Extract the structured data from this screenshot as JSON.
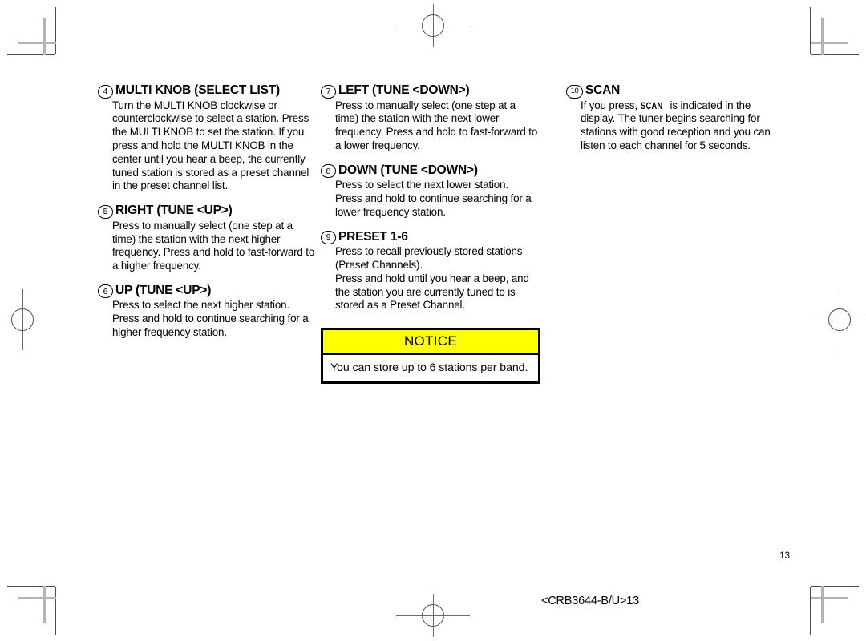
{
  "document": {
    "page_number": "13",
    "footer_code": "<CRB3644-B/U>13"
  },
  "columns": [
    {
      "id": "column-1",
      "entries": [
        {
          "number": "4",
          "title": "MULTI KNOB (SELECT LIST)",
          "paragraphs": [
            "Turn the MULTI KNOB clockwise or counterclockwise to select a station. Press the MULTI KNOB to set the station. If you press and hold the MULTI KNOB in the center until you hear a beep, the currently tuned station is stored as a preset channel in the preset channel list."
          ]
        },
        {
          "number": "5",
          "title": "RIGHT (TUNE <UP>)",
          "paragraphs": [
            "Press to manually select (one step at a time) the station with the next higher frequency. Press and hold to fast-forward to a higher frequency."
          ]
        },
        {
          "number": "6",
          "title": "UP (TUNE <UP>)",
          "paragraphs": [
            "Press to select the next higher station.",
            "Press and hold to continue searching for a higher frequency station."
          ]
        }
      ]
    },
    {
      "id": "column-2",
      "entries": [
        {
          "number": "7",
          "title": "LEFT (TUNE <DOWN>)",
          "paragraphs": [
            "Press to manually select (one step at a time) the station with the next lower frequency. Press and hold to fast-forward to a lower frequency."
          ]
        },
        {
          "number": "8",
          "title": "DOWN (TUNE <DOWN>)",
          "paragraphs": [
            "Press to select the next lower station.",
            "Press and hold to continue searching for a lower frequency station."
          ]
        },
        {
          "number": "9",
          "title": "PRESET 1-6",
          "paragraphs": [
            "Press to recall previously stored stations (Preset Channels).",
            "Press and hold until you hear a beep, and the station you are currently tuned to is stored as a Preset Channel."
          ]
        }
      ]
    },
    {
      "id": "column-3",
      "entries": [
        {
          "number": "10",
          "title": "SCAN",
          "body_before_token": "If you press, ",
          "body_token": "SCAN",
          "body_after_token": " is indicated in the display. The tuner begins searching for stations with good reception and you can listen to each channel for 5 seconds."
        }
      ]
    }
  ],
  "notice": {
    "header": "NOTICE",
    "body": "You can store up to 6 stations per band."
  },
  "colors": {
    "notice_header_background": "#FFFF00",
    "notice_border": "#000000",
    "text": "#000000",
    "crop_mark_dark": "#4D4D4D",
    "crop_mark_light": "#B3B3B3"
  }
}
